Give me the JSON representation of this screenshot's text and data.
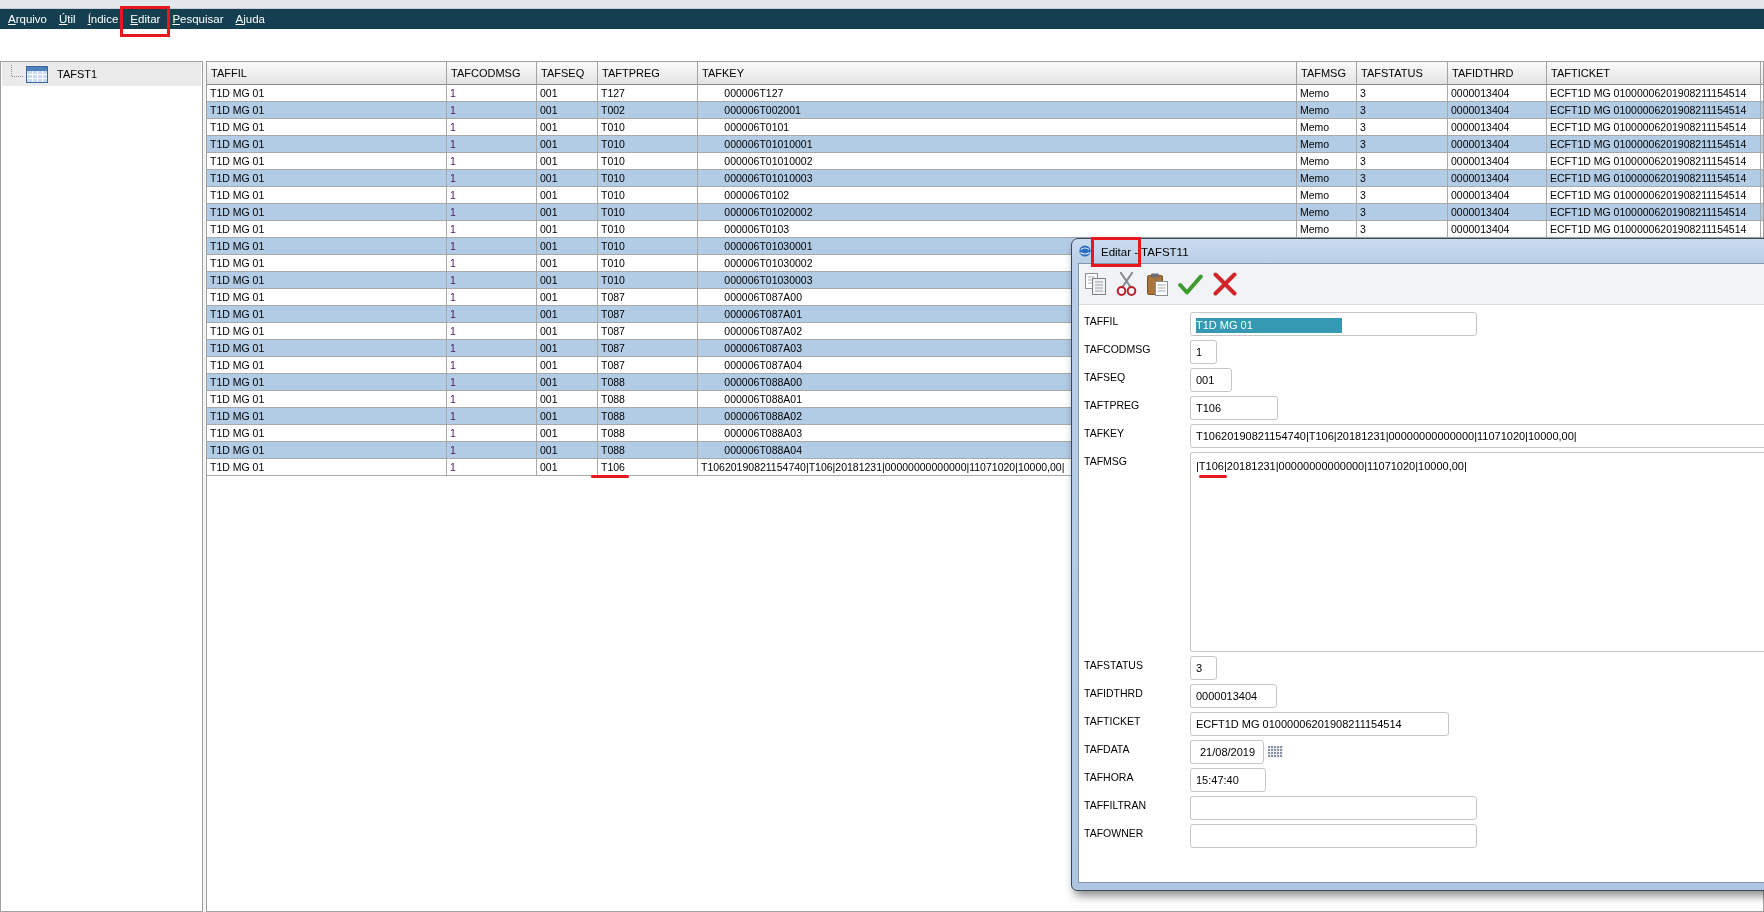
{
  "menu_bar": {
    "items": [
      {
        "label": "Arquivo",
        "marked": false
      },
      {
        "label": "Útil",
        "marked": false
      },
      {
        "label": "Índice",
        "marked": false
      },
      {
        "label": "Editar",
        "marked": true
      },
      {
        "label": "Pesquisar",
        "marked": false
      },
      {
        "label": "Ajuda",
        "marked": false
      }
    ]
  },
  "tree": {
    "items": [
      {
        "label": "TAFST1",
        "selected": true
      }
    ]
  },
  "table": {
    "columns": [
      "TAFFIL",
      "TAFCODMSG",
      "TAFSEQ",
      "TAFTPREG",
      "TAFKEY",
      "TAFMSG",
      "TAFSTATUS",
      "TAFIDTHRD",
      "TAFTICKET"
    ],
    "rows": [
      {
        "cells": [
          "T1D MG 01",
          "1",
          "001",
          "T127",
          "        000006T127",
          "Memo",
          "3",
          "0000013404",
          "ECFT1D MG 01000006201908211154514"
        ],
        "marked": false
      },
      {
        "cells": [
          "T1D MG 01",
          "1",
          "001",
          "T002",
          "        000006T002001",
          "Memo",
          "3",
          "0000013404",
          "ECFT1D MG 01000006201908211154514"
        ],
        "marked": false
      },
      {
        "cells": [
          "T1D MG 01",
          "1",
          "001",
          "T010",
          "        000006T0101",
          "Memo",
          "3",
          "0000013404",
          "ECFT1D MG 01000006201908211154514"
        ],
        "marked": false
      },
      {
        "cells": [
          "T1D MG 01",
          "1",
          "001",
          "T010",
          "        000006T01010001",
          "Memo",
          "3",
          "0000013404",
          "ECFT1D MG 01000006201908211154514"
        ],
        "marked": false
      },
      {
        "cells": [
          "T1D MG 01",
          "1",
          "001",
          "T010",
          "        000006T01010002",
          "Memo",
          "3",
          "0000013404",
          "ECFT1D MG 01000006201908211154514"
        ],
        "marked": false
      },
      {
        "cells": [
          "T1D MG 01",
          "1",
          "001",
          "T010",
          "        000006T01010003",
          "Memo",
          "3",
          "0000013404",
          "ECFT1D MG 01000006201908211154514"
        ],
        "marked": false
      },
      {
        "cells": [
          "T1D MG 01",
          "1",
          "001",
          "T010",
          "        000006T0102",
          "Memo",
          "3",
          "0000013404",
          "ECFT1D MG 01000006201908211154514"
        ],
        "marked": false
      },
      {
        "cells": [
          "T1D MG 01",
          "1",
          "001",
          "T010",
          "        000006T01020002",
          "Memo",
          "3",
          "0000013404",
          "ECFT1D MG 01000006201908211154514"
        ],
        "marked": false
      },
      {
        "cells": [
          "T1D MG 01",
          "1",
          "001",
          "T010",
          "        000006T0103",
          "Memo",
          "3",
          "0000013404",
          "ECFT1D MG 01000006201908211154514"
        ],
        "marked": false
      },
      {
        "cells": [
          "T1D MG 01",
          "1",
          "001",
          "T010",
          "        000006T01030001"
        ],
        "marked": false
      },
      {
        "cells": [
          "T1D MG 01",
          "1",
          "001",
          "T010",
          "        000006T01030002"
        ],
        "marked": false
      },
      {
        "cells": [
          "T1D MG 01",
          "1",
          "001",
          "T010",
          "        000006T01030003"
        ],
        "marked": false
      },
      {
        "cells": [
          "T1D MG 01",
          "1",
          "001",
          "T087",
          "        000006T087A00"
        ],
        "marked": false
      },
      {
        "cells": [
          "T1D MG 01",
          "1",
          "001",
          "T087",
          "        000006T087A01"
        ],
        "marked": false
      },
      {
        "cells": [
          "T1D MG 01",
          "1",
          "001",
          "T087",
          "        000006T087A02"
        ],
        "marked": false
      },
      {
        "cells": [
          "T1D MG 01",
          "1",
          "001",
          "T087",
          "        000006T087A03"
        ],
        "marked": false
      },
      {
        "cells": [
          "T1D MG 01",
          "1",
          "001",
          "T087",
          "        000006T087A04"
        ],
        "marked": false
      },
      {
        "cells": [
          "T1D MG 01",
          "1",
          "001",
          "T088",
          "        000006T088A00"
        ],
        "marked": false
      },
      {
        "cells": [
          "T1D MG 01",
          "1",
          "001",
          "T088",
          "        000006T088A01"
        ],
        "marked": false
      },
      {
        "cells": [
          "T1D MG 01",
          "1",
          "001",
          "T088",
          "        000006T088A02"
        ],
        "marked": false
      },
      {
        "cells": [
          "T1D MG 01",
          "1",
          "001",
          "T088",
          "        000006T088A03"
        ],
        "marked": false
      },
      {
        "cells": [
          "T1D MG 01",
          "1",
          "001",
          "T088",
          "        000006T088A04"
        ],
        "marked": false
      },
      {
        "cells": [
          "T1D MG 01",
          "1",
          "001",
          "T106",
          "T10620190821154740|T106|20181231|00000000000000|11071020|10000,00|"
        ],
        "marked": true
      }
    ]
  },
  "dialog": {
    "title": "Editar - TAFST11",
    "title_marked": true,
    "toolbar": [
      {
        "kind": "copy"
      },
      {
        "kind": "cut"
      },
      {
        "kind": "paste"
      },
      {
        "kind": "confirm"
      },
      {
        "kind": "cancel"
      }
    ],
    "fields": [
      {
        "label": "TAFFIL",
        "kind": "text",
        "value": "T1D MG 01",
        "text_selected": true,
        "marked": false
      },
      {
        "label": "TAFCODMSG",
        "kind": "text",
        "value": "1",
        "text_selected": false,
        "marked": false
      },
      {
        "label": "TAFSEQ",
        "kind": "text",
        "value": "001",
        "text_selected": false,
        "marked": false
      },
      {
        "label": "TAFTPREG",
        "kind": "text",
        "value": "T106",
        "text_selected": false,
        "marked": false
      },
      {
        "label": "TAFKEY",
        "kind": "text",
        "value": "T10620190821154740|T106|20181231|00000000000000|11071020|10000,00|",
        "text_selected": false,
        "marked": false
      },
      {
        "label": "TAFMSG",
        "kind": "memo",
        "value": "|T106|20181231|00000000000000|11071020|10000,00|",
        "text_selected": false,
        "marked": true
      },
      {
        "label": "TAFSTATUS",
        "kind": "text",
        "value": "3",
        "text_selected": false,
        "marked": false
      },
      {
        "label": "TAFIDTHRD",
        "kind": "text",
        "value": "0000013404",
        "text_selected": false,
        "marked": false
      },
      {
        "label": "TAFTICKET",
        "kind": "text",
        "value": "ECFT1D MG 01000006201908211154514",
        "text_selected": false,
        "marked": false
      },
      {
        "label": "TAFDATA",
        "kind": "date",
        "value": "21/08/2019",
        "text_selected": false,
        "marked": false
      },
      {
        "label": "TAFHORA",
        "kind": "text",
        "value": "15:47:40",
        "text_selected": false,
        "marked": false
      },
      {
        "label": "TAFFILTRAN",
        "kind": "text",
        "text_selected": false,
        "marked": false
      },
      {
        "label": "TAFOWNER",
        "kind": "text",
        "text_selected": false,
        "marked": false
      }
    ]
  }
}
